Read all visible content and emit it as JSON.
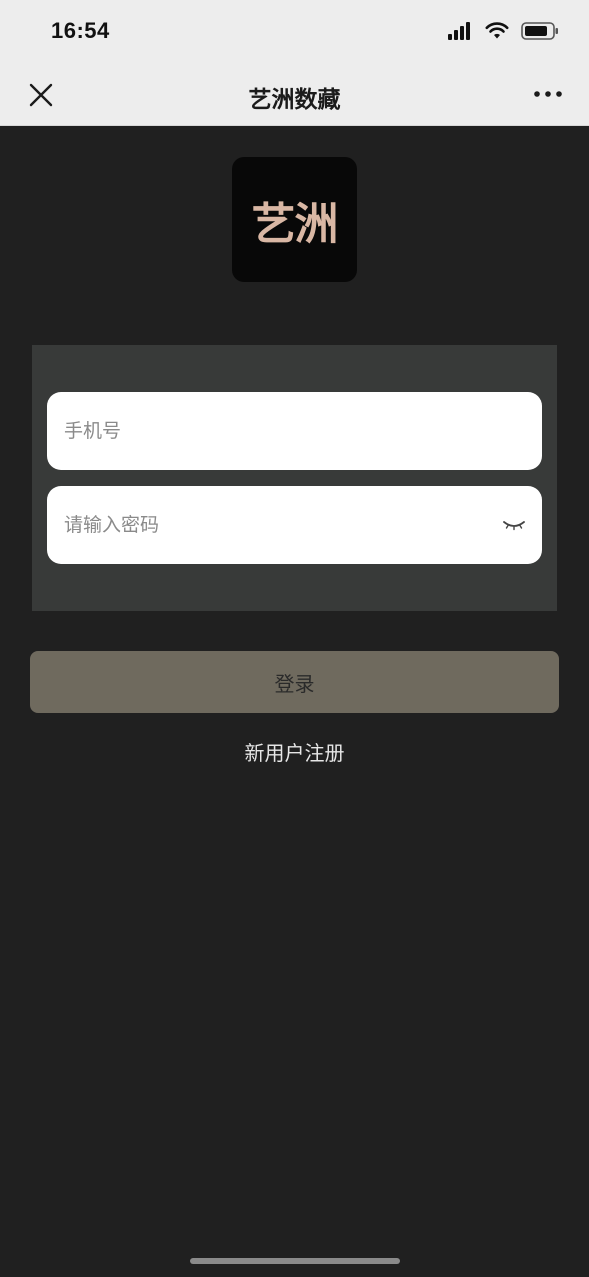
{
  "status_bar": {
    "time": "16:54",
    "icons": [
      "signal-icon",
      "wifi-icon",
      "battery-icon"
    ]
  },
  "nav": {
    "title": "艺洲数藏",
    "close_icon": "close-icon",
    "more_icon": "more-icon"
  },
  "logo": {
    "text": "艺洲"
  },
  "form": {
    "phone_placeholder": "手机号",
    "password_placeholder": "请输入密码",
    "password_toggle_icon": "eye-closed-icon"
  },
  "actions": {
    "login_label": "登录",
    "register_label": "新用户注册"
  },
  "colors": {
    "background": "#202020",
    "panel": "#383a39",
    "login_button": "#6f6a5e",
    "logo_text": "#d9b7a4"
  }
}
